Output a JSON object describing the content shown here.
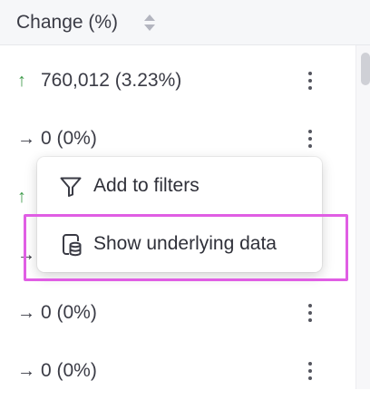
{
  "table": {
    "column_header": "Change (%)",
    "rows": [
      {
        "direction": "up",
        "arrow": "↑",
        "value": "760,012 (3.23%)"
      },
      {
        "direction": "flat",
        "arrow": "→",
        "value": "0 (0%)"
      },
      {
        "direction": "up",
        "arrow": "↑",
        "value": ""
      },
      {
        "direction": "flat",
        "arrow": "→",
        "value": ""
      },
      {
        "direction": "flat",
        "arrow": "→",
        "value": "0 (0%)"
      },
      {
        "direction": "flat",
        "arrow": "→",
        "value": "0 (0%)"
      }
    ]
  },
  "context_menu": {
    "items": [
      {
        "label": "Add to filters",
        "icon": "filter-icon"
      },
      {
        "label": "Show underlying data",
        "icon": "database-icon"
      }
    ]
  },
  "annotation": {
    "highlighted_item": "Show underlying data",
    "color": "#e05ee4"
  },
  "colors": {
    "up_arrow": "#3f9b4b",
    "header_bg": "#f6f7f9"
  }
}
